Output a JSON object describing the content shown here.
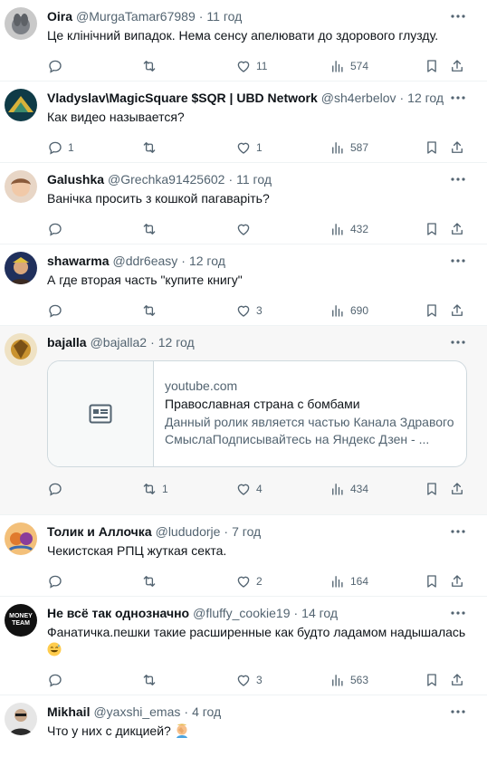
{
  "tweets": [
    {
      "name": "Oira",
      "handle": "@MurgaTamar67989",
      "time": "11 год",
      "text": "Це клінічний випадок. Нема сенсу апелювати до здорового глузду.",
      "replies": "",
      "retweets": "",
      "likes": "11",
      "views": "574",
      "avatar_color": "#9aa0a6"
    },
    {
      "name": "Vladyslav\\MagicSquare $SQR | UBD Network",
      "handle": "@sh4erbelov",
      "time": "12 год",
      "text": "Как видео называется?",
      "replies": "1",
      "retweets": "",
      "likes": "1",
      "views": "587",
      "avatar_color": "#1d4d5a"
    },
    {
      "name": "Galushka",
      "handle": "@Grechka91425602",
      "time": "11 год",
      "text": "Ванічка просить з кошкой пагаваріть?",
      "replies": "",
      "retweets": "",
      "likes": "",
      "views": "432",
      "avatar_color": "#c79a7a"
    },
    {
      "name": "shawarma",
      "handle": "@ddr6easy",
      "time": "12 год",
      "text": "А где вторая часть \"купите книгу\"",
      "replies": "",
      "retweets": "",
      "likes": "3",
      "views": "690",
      "avatar_color": "#2b3a66"
    },
    {
      "name": "bajalla",
      "handle": "@bajalla2",
      "time": "12 год",
      "text": "",
      "replies": "",
      "retweets": "1",
      "likes": "4",
      "views": "434",
      "avatar_color": "#b38b3a",
      "card": {
        "domain": "youtube.com",
        "title": "Православная страна с бомбами",
        "desc1": "Данный ролик является частью Канала Здравого",
        "desc2": "СмыслаПодписывайтесь на Яндекс Дзен - ..."
      }
    },
    {
      "name": "Толик и Аллочка",
      "handle": "@lududorje",
      "time": "7 год",
      "text": "Чекистская РПЦ жуткая секта.",
      "replies": "",
      "retweets": "",
      "likes": "2",
      "views": "164",
      "avatar_color": "#d98a3a"
    },
    {
      "name": "Не всё так однозначно",
      "handle": "@fluffy_cookie19",
      "time": "14 год",
      "text": "Фанатичка.пешки такие расширенные как будто ладамом надышалась",
      "emoji": "sweat-smile-emoji",
      "replies": "",
      "retweets": "",
      "likes": "3",
      "views": "563",
      "avatar_color": "#111111",
      "avatar_text": "MONEY TEAM"
    },
    {
      "name": "Mikhail",
      "handle": "@yaxshi_emas",
      "time": "4 год",
      "text": "Что у них с дикцией?",
      "emoji": "facepalm-emoji",
      "replies": "",
      "retweets": "",
      "likes": "",
      "views": "",
      "avatar_color": "#6b6b6b"
    }
  ]
}
